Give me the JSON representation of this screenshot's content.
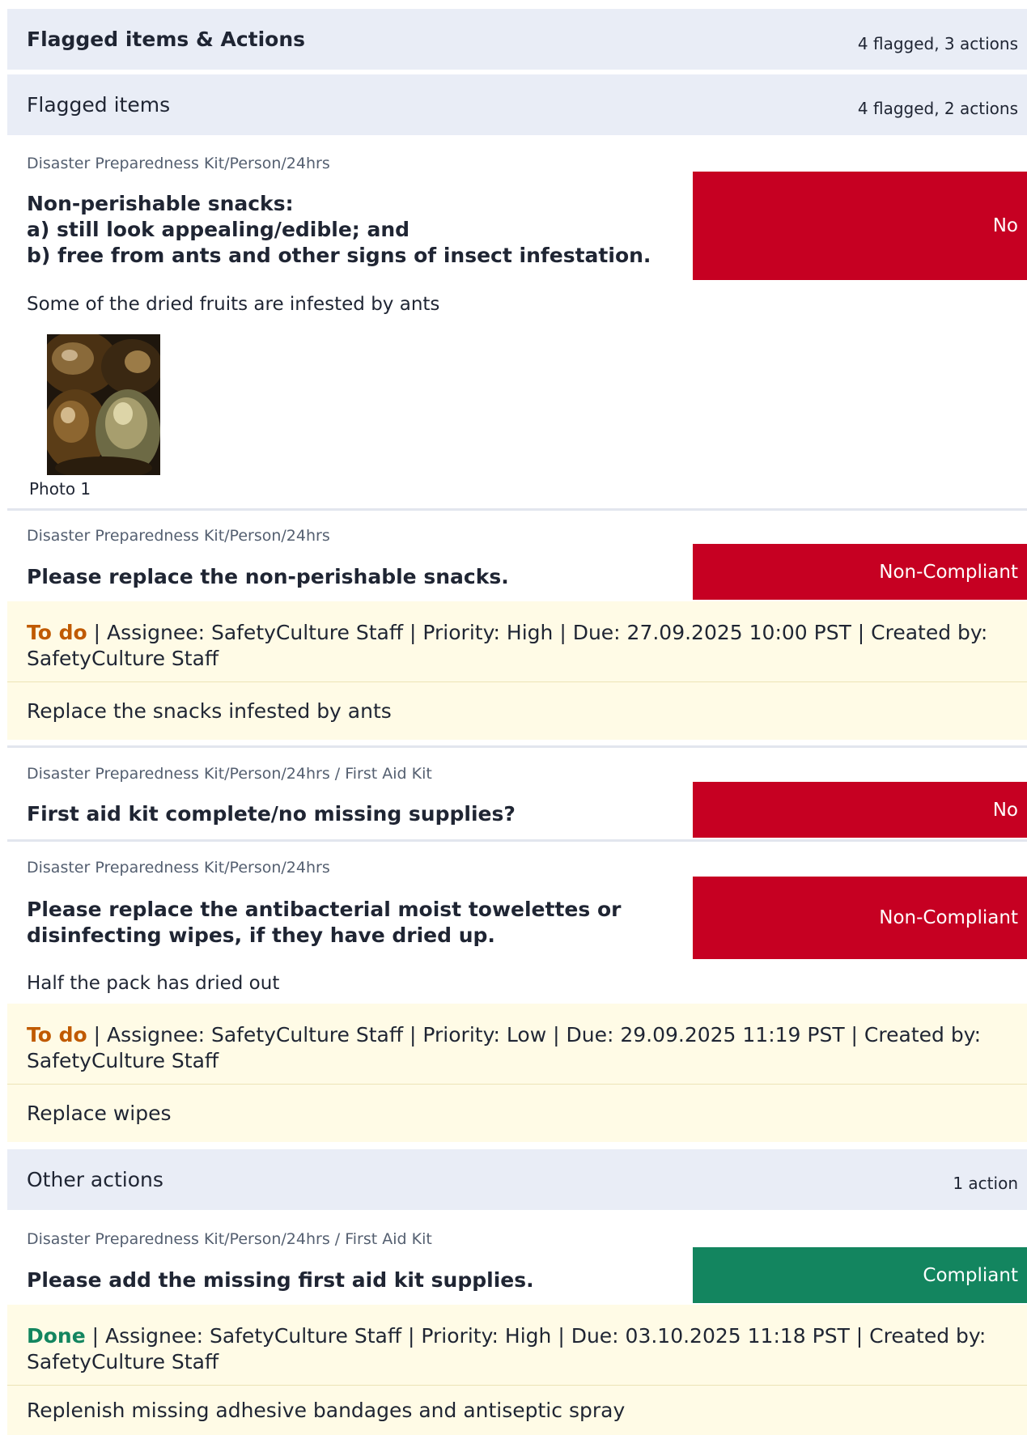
{
  "summary": {
    "title": "Flagged items & Actions",
    "count": "4 flagged, 3 actions"
  },
  "flagged_section": {
    "title": "Flagged items",
    "count": "4 flagged, 2 actions"
  },
  "items": [
    {
      "breadcrumb": "Disaster Preparedness Kit/Person/24hrs",
      "question_lines": [
        "Non-perishable snacks:",
        "a) still look appealing/edible; and",
        "b) free from ants and other signs of insect infestation."
      ],
      "response": "No",
      "response_color": "#c60022",
      "note": "Some of the dried fruits are infested by ants",
      "photo_caption": "Photo 1"
    },
    {
      "breadcrumb": "Disaster Preparedness Kit/Person/24hrs",
      "question": "Please replace the non-perishable snacks.",
      "response": "Non-Compliant",
      "response_color": "#c60022",
      "action": {
        "status": "To do",
        "meta": " | Assignee: SafetyCulture Staff | Priority: High | Due: 27.09.2025 10:00 PST | Created by: SafetyCulture Staff",
        "description": "Replace the snacks infested by ants"
      }
    },
    {
      "breadcrumb": "Disaster Preparedness Kit/Person/24hrs / First Aid Kit",
      "question": "First aid kit complete/no missing supplies?",
      "response": "No",
      "response_color": "#c60022"
    },
    {
      "breadcrumb": "Disaster Preparedness Kit/Person/24hrs",
      "question_lines": [
        "Please replace the antibacterial moist towelettes or",
        "disinfecting wipes, if they have dried up."
      ],
      "response": "Non-Compliant",
      "response_color": "#c60022",
      "note": "Half the pack has dried out",
      "action": {
        "status": "To do",
        "meta": " | Assignee: SafetyCulture Staff | Priority: Low | Due: 29.09.2025 11:19 PST | Created by: SafetyCulture Staff",
        "description": "Replace wipes"
      }
    }
  ],
  "other_section": {
    "title": "Other actions",
    "count": "1 action"
  },
  "other_items": [
    {
      "breadcrumb": "Disaster Preparedness Kit/Person/24hrs / First Aid Kit",
      "question": "Please add the missing first aid kit supplies.",
      "response": "Compliant",
      "response_color": "#13855f",
      "action": {
        "status": "Done",
        "meta": " | Assignee: SafetyCulture Staff | Priority: High | Due: 03.10.2025 11:18 PST | Created by: SafetyCulture Staff",
        "description": "Replenish missing adhesive bandages and antiseptic spray"
      }
    }
  ],
  "colors": {
    "header_bg": "#e9edf6",
    "flag_red": "#c60022",
    "compliant_green": "#13855f",
    "todo_orange": "#c05a00",
    "action_bg": "#fffbe6"
  }
}
